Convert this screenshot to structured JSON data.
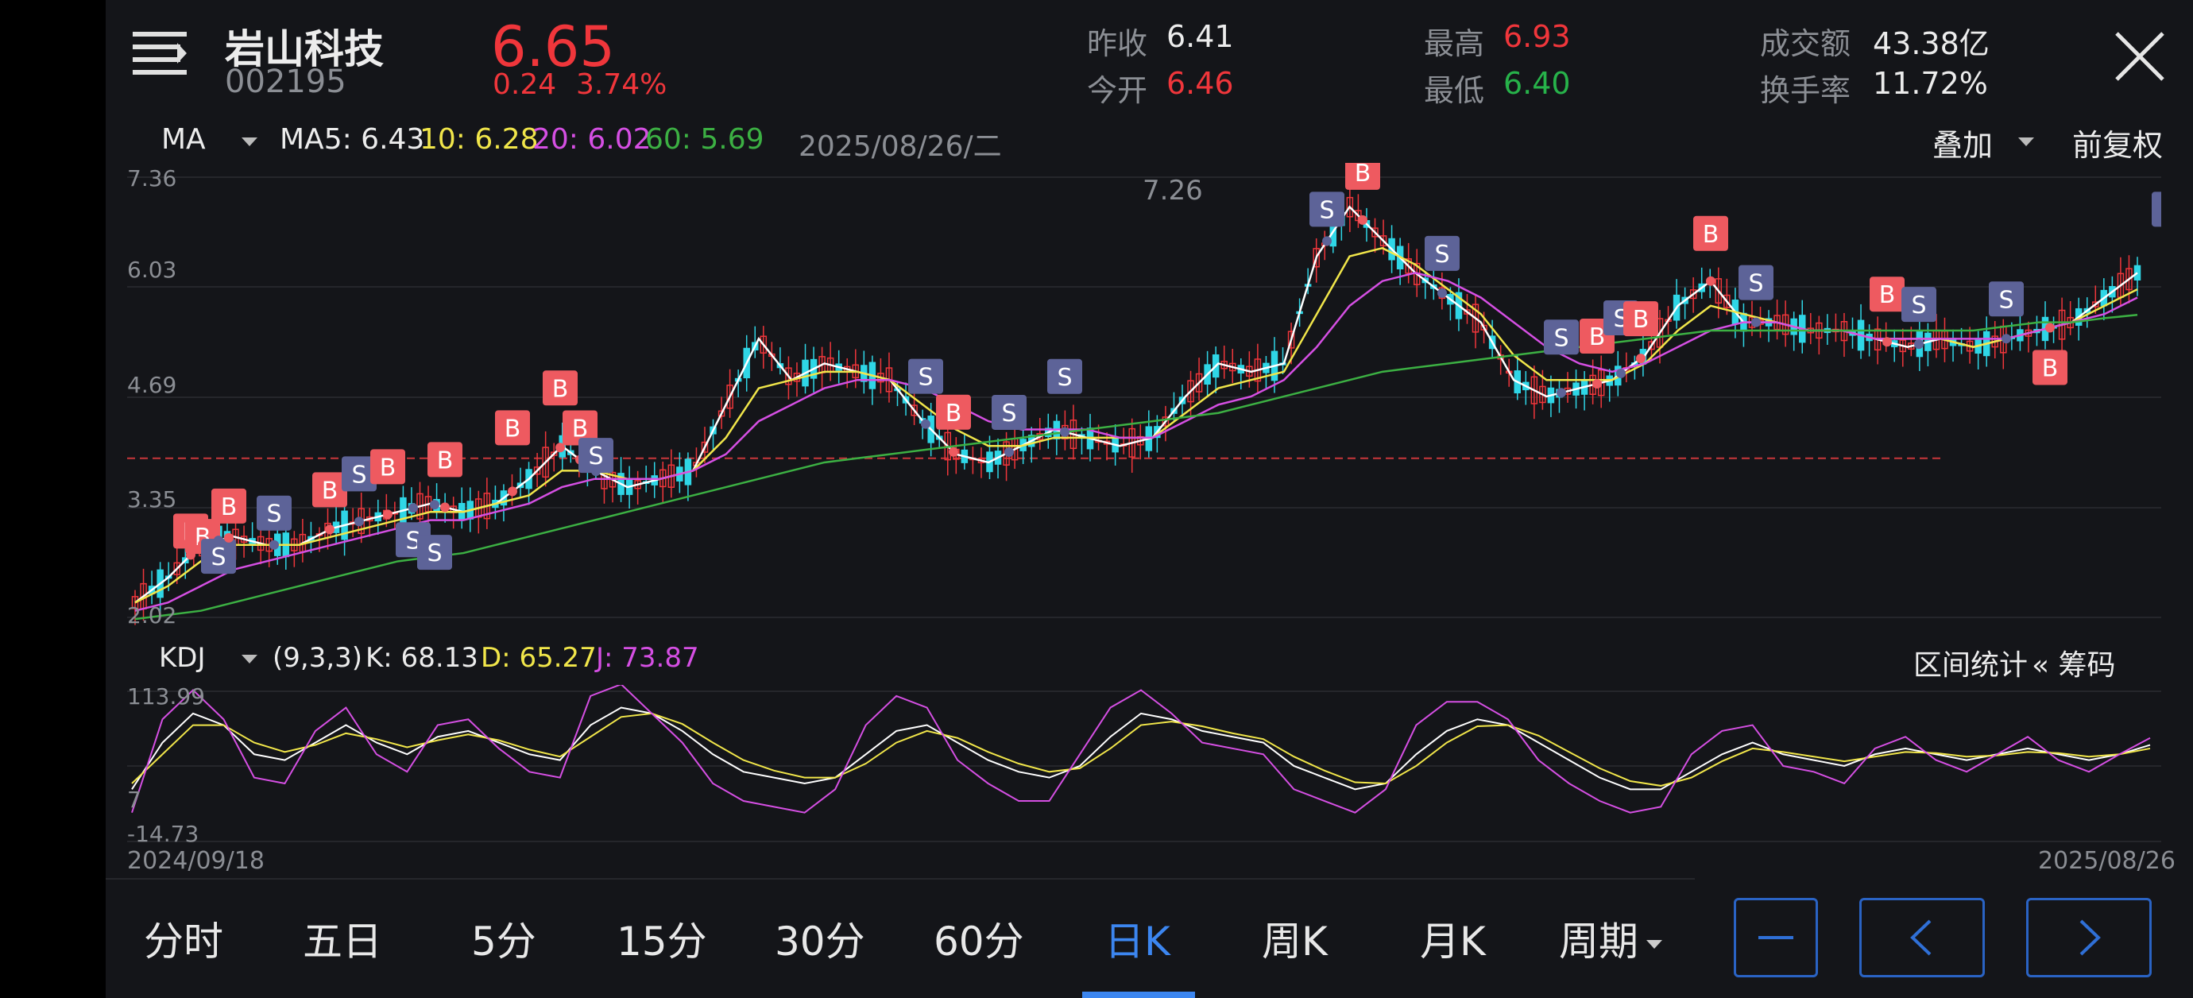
{
  "stock": {
    "name": "岩山科技",
    "code": "002195",
    "price": "6.65",
    "change": "0.24",
    "change_pct": "3.74%"
  },
  "quote": {
    "prev_close_label": "昨收",
    "prev_close": "6.41",
    "open_label": "今开",
    "open": "6.46",
    "high_label": "最高",
    "high": "6.93",
    "low_label": "最低",
    "low": "6.40",
    "amount_label": "成交额",
    "amount": "43.38亿",
    "turnover_label": "换手率",
    "turnover": "11.72%"
  },
  "ma_bar": {
    "indicator": "MA",
    "ma5": "MA5: 6.43",
    "ma10": "10: 6.28",
    "ma20": "20: 6.02",
    "ma60": "60: 5.69",
    "date": "2025/08/26/二",
    "overlay": "叠加",
    "adjust": "前复权"
  },
  "price_axis": {
    "top": "7.36",
    "l2": "6.03",
    "l3": "4.69",
    "l4": "3.35",
    "bottom": "2.02",
    "peak": "7.26"
  },
  "kdj_bar": {
    "indicator": "KDJ",
    "params": "(9,3,3)",
    "k": "K: 68.13",
    "d": "D: 65.27",
    "j": "J: 73.87",
    "range_stats": "区间统计",
    "chips": "« 筹码"
  },
  "kdj_axis": {
    "top": "113.99",
    "mid": "7",
    "bottom": "-14.73"
  },
  "dates": {
    "start": "2024/09/18",
    "end": "2025/08/26"
  },
  "tabs": [
    "分时",
    "五日",
    "5分",
    "15分",
    "30分",
    "60分",
    "日K",
    "周K",
    "月K",
    "周期"
  ],
  "active_tab": 6,
  "colors": {
    "up": "#f0363b",
    "down": "#2fd6e6",
    "ma5": "#ffffff",
    "ma10": "#f1e64a",
    "ma20": "#d54fe3",
    "ma60": "#3cb043",
    "accent": "#3c86f0"
  },
  "chart_data": [
    {
      "type": "candlestick",
      "title": "",
      "x_range": [
        "2024/09/18",
        "2025/08/26"
      ],
      "ylim": [
        2.02,
        7.36
      ],
      "y_ticks": [
        7.36,
        6.03,
        4.69,
        3.35,
        2.02
      ],
      "annotation": "7.26",
      "series": [
        {
          "name": "MA5",
          "values": [
            2.2,
            2.5,
            2.9,
            3.0,
            2.9,
            2.9,
            3.1,
            3.2,
            3.3,
            3.4,
            3.3,
            3.4,
            3.7,
            4.1,
            3.8,
            3.6,
            3.7,
            3.8,
            4.6,
            5.4,
            4.9,
            5.1,
            5.0,
            4.9,
            4.4,
            4.0,
            3.9,
            4.1,
            4.3,
            4.2,
            4.1,
            4.2,
            4.7,
            5.1,
            5.0,
            5.1,
            6.4,
            7.0,
            6.6,
            6.2,
            5.9,
            5.6,
            4.9,
            4.7,
            4.8,
            4.9,
            5.2,
            5.8,
            6.1,
            5.6,
            5.6,
            5.5,
            5.5,
            5.4,
            5.3,
            5.4,
            5.3,
            5.4,
            5.5,
            5.6,
            5.9,
            6.2
          ]
        },
        {
          "name": "10",
          "values": [
            2.2,
            2.4,
            2.7,
            2.9,
            2.9,
            2.9,
            3.0,
            3.1,
            3.2,
            3.3,
            3.3,
            3.4,
            3.5,
            3.8,
            3.8,
            3.7,
            3.7,
            3.8,
            4.2,
            4.8,
            4.9,
            5.0,
            5.0,
            4.9,
            4.6,
            4.3,
            4.1,
            4.1,
            4.2,
            4.2,
            4.2,
            4.2,
            4.5,
            4.8,
            4.9,
            5.0,
            5.7,
            6.4,
            6.5,
            6.3,
            6.0,
            5.7,
            5.2,
            4.9,
            4.9,
            4.9,
            5.1,
            5.5,
            5.8,
            5.7,
            5.6,
            5.5,
            5.5,
            5.4,
            5.4,
            5.4,
            5.3,
            5.4,
            5.5,
            5.6,
            5.8,
            6.0
          ]
        },
        {
          "name": "20",
          "values": [
            2.1,
            2.2,
            2.4,
            2.6,
            2.7,
            2.8,
            2.9,
            3.0,
            3.1,
            3.2,
            3.2,
            3.3,
            3.4,
            3.6,
            3.7,
            3.7,
            3.7,
            3.8,
            4.0,
            4.4,
            4.6,
            4.8,
            4.9,
            4.9,
            4.8,
            4.6,
            4.4,
            4.3,
            4.3,
            4.3,
            4.2,
            4.2,
            4.4,
            4.6,
            4.7,
            4.9,
            5.3,
            5.8,
            6.1,
            6.2,
            6.1,
            5.9,
            5.6,
            5.3,
            5.1,
            5.0,
            5.1,
            5.3,
            5.5,
            5.6,
            5.6,
            5.5,
            5.5,
            5.4,
            5.4,
            5.4,
            5.4,
            5.4,
            5.5,
            5.6,
            5.7,
            5.9
          ]
        },
        {
          "name": "60",
          "values": [
            2.0,
            2.05,
            2.1,
            2.2,
            2.3,
            2.4,
            2.5,
            2.6,
            2.7,
            2.75,
            2.8,
            2.9,
            3.0,
            3.1,
            3.2,
            3.3,
            3.4,
            3.5,
            3.6,
            3.7,
            3.8,
            3.9,
            3.95,
            4.0,
            4.05,
            4.1,
            4.15,
            4.2,
            4.25,
            4.3,
            4.35,
            4.4,
            4.45,
            4.5,
            4.6,
            4.7,
            4.8,
            4.9,
            5.0,
            5.05,
            5.1,
            5.15,
            5.2,
            5.25,
            5.3,
            5.35,
            5.4,
            5.45,
            5.5,
            5.5,
            5.5,
            5.5,
            5.5,
            5.5,
            5.5,
            5.5,
            5.5,
            5.55,
            5.6,
            5.6,
            5.65,
            5.69
          ]
        }
      ]
    },
    {
      "type": "line",
      "title": "",
      "ylim": [
        -14.73,
        113.99
      ],
      "series": [
        {
          "name": "K",
          "values": [
            30,
            70,
            95,
            85,
            60,
            55,
            70,
            85,
            70,
            60,
            75,
            80,
            70,
            60,
            55,
            85,
            100,
            95,
            80,
            60,
            45,
            40,
            35,
            40,
            60,
            80,
            85,
            70,
            55,
            45,
            40,
            50,
            75,
            95,
            90,
            80,
            75,
            70,
            50,
            40,
            30,
            35,
            60,
            80,
            90,
            85,
            70,
            55,
            40,
            30,
            30,
            45,
            60,
            70,
            60,
            55,
            50,
            60,
            65,
            60,
            55,
            60,
            65,
            60,
            55,
            60,
            68
          ]
        },
        {
          "name": "D",
          "values": [
            35,
            60,
            85,
            85,
            70,
            62,
            68,
            78,
            73,
            66,
            72,
            77,
            72,
            64,
            58,
            75,
            92,
            95,
            86,
            70,
            55,
            46,
            40,
            40,
            52,
            70,
            80,
            74,
            62,
            52,
            45,
            48,
            65,
            85,
            88,
            84,
            78,
            73,
            58,
            46,
            36,
            35,
            50,
            70,
            84,
            85,
            76,
            62,
            48,
            37,
            33,
            40,
            54,
            65,
            62,
            58,
            54,
            58,
            62,
            61,
            58,
            59,
            62,
            61,
            58,
            60,
            65
          ]
        },
        {
          "name": "J",
          "values": [
            10,
            90,
            115,
            90,
            40,
            35,
            80,
            100,
            60,
            45,
            85,
            90,
            65,
            45,
            40,
            110,
            120,
            95,
            70,
            35,
            20,
            15,
            10,
            30,
            85,
            110,
            100,
            55,
            35,
            20,
            20,
            60,
            100,
            115,
            95,
            70,
            65,
            60,
            30,
            20,
            10,
            30,
            85,
            105,
            105,
            90,
            55,
            35,
            20,
            10,
            15,
            60,
            80,
            85,
            50,
            45,
            35,
            65,
            75,
            55,
            45,
            60,
            75,
            55,
            45,
            60,
            74
          ]
        }
      ]
    }
  ]
}
